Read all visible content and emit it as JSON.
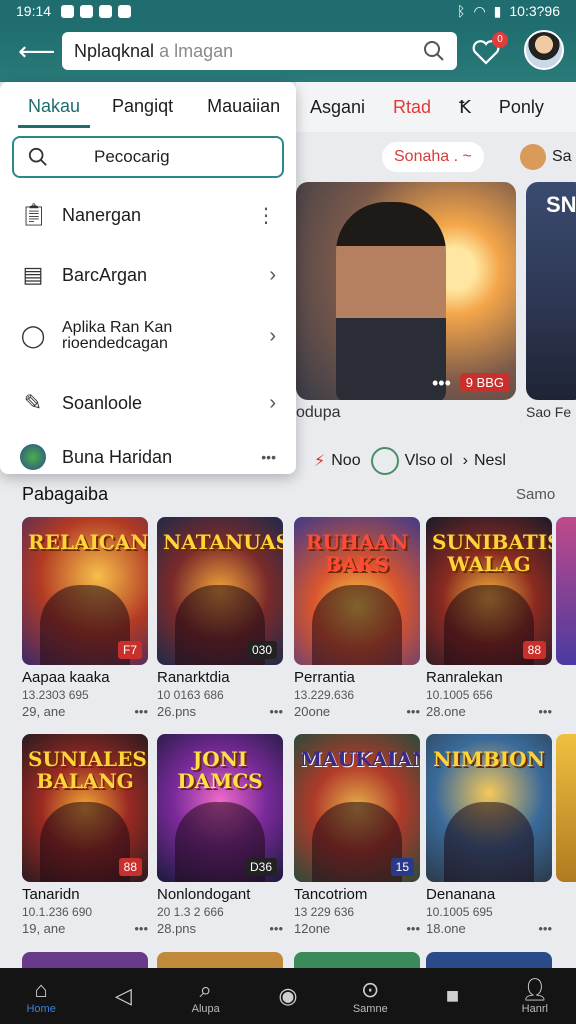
{
  "status": {
    "time_left": "19:14",
    "time_right": "10:3?96"
  },
  "search": {
    "query": "Nplaqknal",
    "hint": "a lmagan"
  },
  "notif_badge": "0",
  "right_tabs": [
    "Asgani",
    "Rtad",
    "Ponly"
  ],
  "chips": {
    "schedule": "Sonaha .",
    "user": "Sa"
  },
  "hero": {
    "caption": "odupa",
    "views": "9 BBG",
    "side_title": "SN",
    "side_caption": "Sao Fe"
  },
  "actions": {
    "a": "Noo",
    "b": "Vlso ol",
    "c": "Nesl"
  },
  "section": {
    "title": "Pabagaiba",
    "more": "Samo"
  },
  "panel": {
    "tabs": [
      "Nakau",
      "Pangiqt",
      "Mauaiian"
    ],
    "search_placeholder": "Pecocarig",
    "items": [
      {
        "label": "Nanergan",
        "icon": "clipboard-icon"
      },
      {
        "label": "BarcArgan",
        "icon": "document-icon"
      },
      {
        "label": "Aplika Ran Kan\nrioendedcagan",
        "icon": "chat-icon"
      },
      {
        "label": "Soanloole",
        "icon": "pencil-icon"
      },
      {
        "label": "Buna Haridan",
        "icon": "app-icon"
      }
    ]
  },
  "cards": [
    {
      "title": "RELAICAN",
      "name": "Aapaa kaaka",
      "meta": "13.2303 695",
      "meta2": "29, ane",
      "tag": "F7"
    },
    {
      "title": "NATANUAS",
      "name": "Ranarktdia",
      "meta": "10 0163 686",
      "meta2": "26.pns",
      "tag": "030"
    },
    {
      "title": "RUHAAN BAKS",
      "name": "Perrantia",
      "meta": "13.229.636",
      "meta2": "20one",
      "tag": ""
    },
    {
      "title": "SUNIBATIS WALAG",
      "name": "Ranralekan",
      "meta": "10.1005 656",
      "meta2": "28.one",
      "tag": "88"
    },
    {
      "title": "SUNIALES BALANG",
      "name": "Tanaridn",
      "meta": "10.1.236 690",
      "meta2": "19, ane",
      "tag": "88"
    },
    {
      "title": "JONI DAMCS",
      "name": "Nonlondogant",
      "meta": "20 1.3 2 666",
      "meta2": "28.pns",
      "tag": "D36"
    },
    {
      "title": "MAUKAIAN",
      "name": "Tancotriom",
      "meta": "13 229 636",
      "meta2": "12one",
      "tag": "15"
    },
    {
      "title": "NIMBION",
      "name": "Denanana",
      "meta": "10.1005 695",
      "meta2": "18.one",
      "tag": ""
    }
  ],
  "nav": [
    "Home",
    "Alupa",
    "",
    "Samne",
    "",
    "Hanrl"
  ]
}
